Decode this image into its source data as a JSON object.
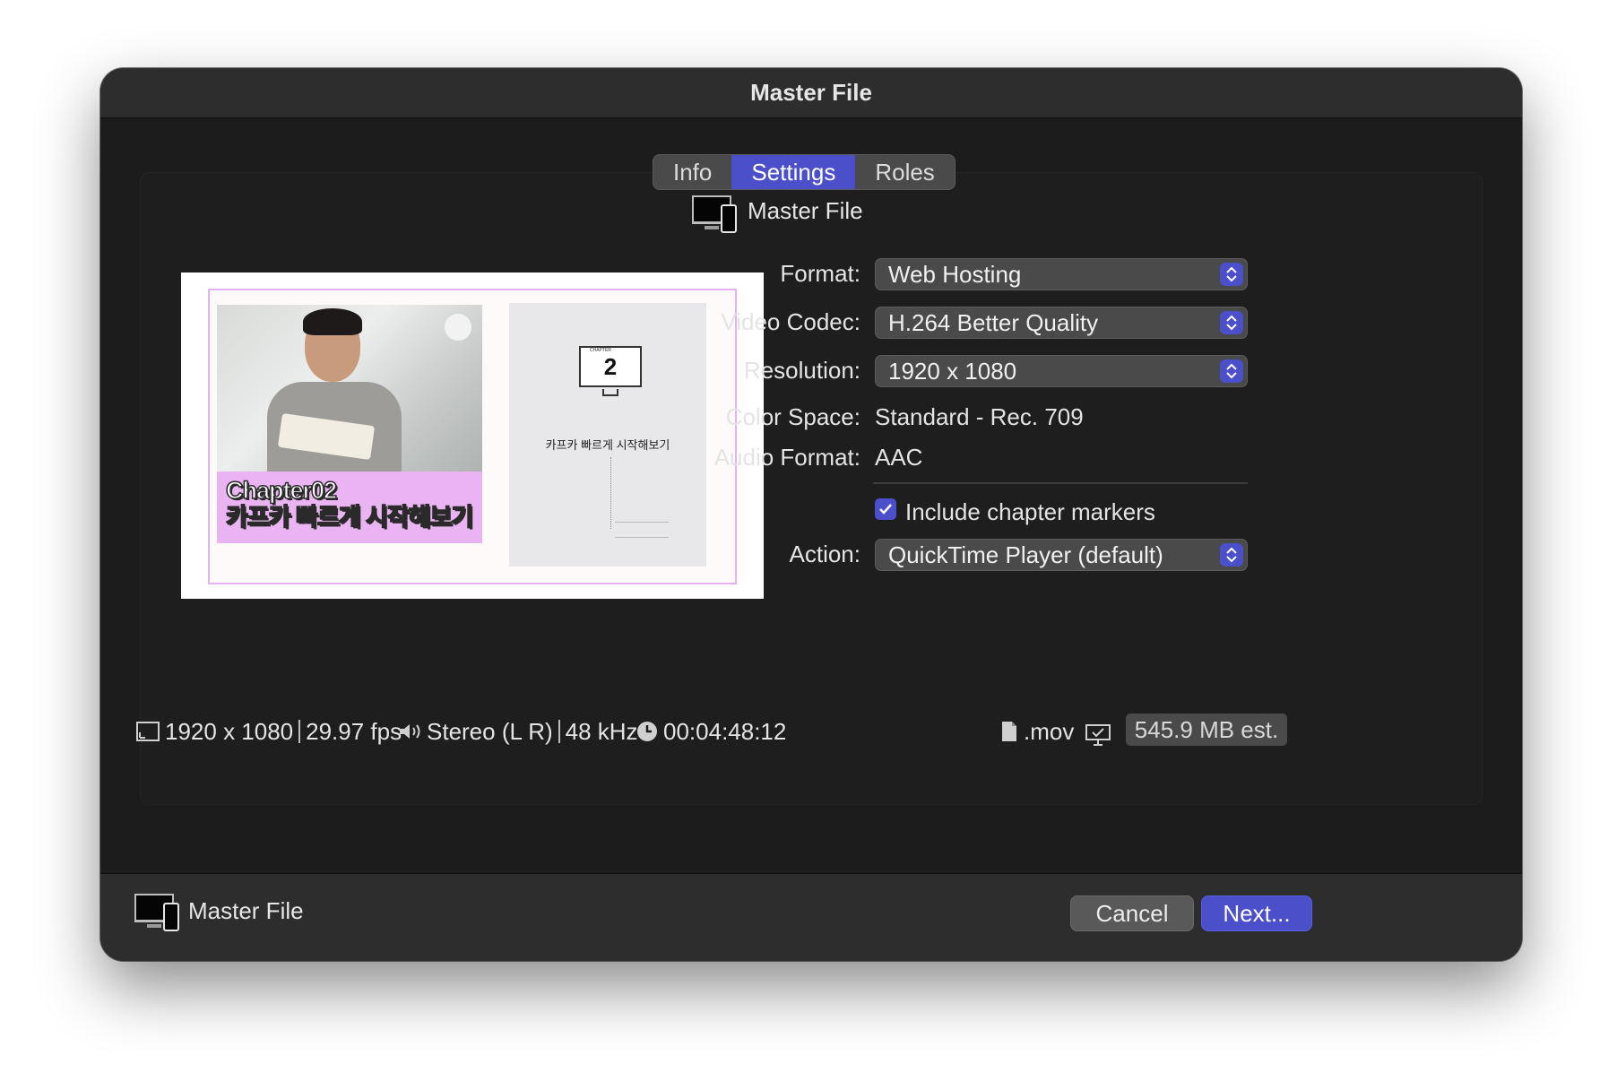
{
  "window": {
    "title": "Master File"
  },
  "tabs": [
    {
      "label": "Info",
      "active": false
    },
    {
      "label": "Settings",
      "active": true
    },
    {
      "label": "Roles",
      "active": false
    }
  ],
  "preview": {
    "caption_line1": "Chapter02",
    "caption_line2": "카프카 빠르게 시작해보기",
    "page_number": "2",
    "page_chapter_label": "CHAPTER",
    "page_title": "카프카 빠르게 시작해보기"
  },
  "destination": {
    "label": "Master File"
  },
  "settings": {
    "format": {
      "label": "Format:",
      "value": "Web Hosting"
    },
    "video_codec": {
      "label": "Video Codec:",
      "value": "H.264 Better Quality"
    },
    "resolution": {
      "label": "Resolution:",
      "value": "1920 x 1080"
    },
    "color_space": {
      "label": "Color Space:",
      "value": "Standard - Rec. 709"
    },
    "audio_format": {
      "label": "Audio Format:",
      "value": "AAC"
    },
    "chapter_markers": {
      "label": "Include chapter markers",
      "checked": true
    },
    "action": {
      "label": "Action:",
      "value": "QuickTime Player (default)"
    }
  },
  "status": {
    "resolution": "1920 x 1080",
    "fps": "29.97 fps",
    "audio_channels": "Stereo (L R)",
    "sample_rate": "48 kHz",
    "duration": "00:04:48:12",
    "extension": ".mov",
    "size_estimate": "545.9 MB est."
  },
  "footer": {
    "label": "Master File",
    "cancel_label": "Cancel",
    "next_label": "Next..."
  },
  "colors": {
    "accent": "#4b4fc9",
    "caption_band": "#e9b4f1"
  }
}
